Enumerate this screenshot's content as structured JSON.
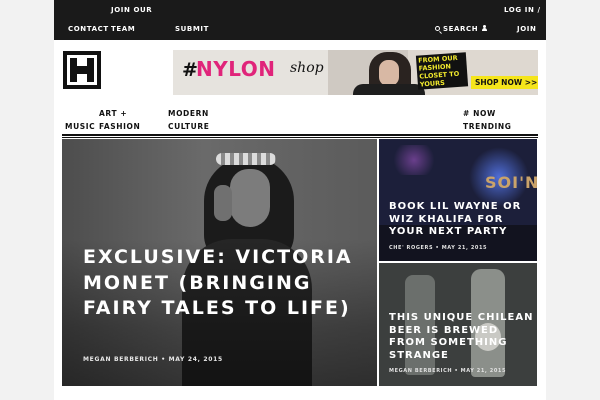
{
  "topbar": {
    "contact": "CONTACT",
    "join_team_line1": "JOIN OUR",
    "join_team_line2": "TEAM",
    "submit": "SUBMIT",
    "search": "SEARCH",
    "login": "LOG IN /",
    "join": "JOIN",
    "icons": [
      "search-icon",
      "user-icon"
    ]
  },
  "logo": {
    "letter": "H",
    "icon": "logo"
  },
  "banner": {
    "hash": "#",
    "brand": "NYLON",
    "shop": "shop",
    "tagline": "FROM OUR FASHION CLOSET TO YOURS",
    "cta": "SHOP NOW >>",
    "colors": {
      "brand": "#e0247a",
      "cta_bg": "#f5e51b"
    }
  },
  "nav": {
    "music": "MUSIC",
    "art_line1": "ART +",
    "art_line2": "FASHION",
    "modern_line1": "MODERN",
    "modern_line2": "CULTURE",
    "now_line1": "# NOW",
    "now_line2": "TRENDING"
  },
  "feature": {
    "headline": "EXCLUSIVE: VICTORIA MONET (BRINGING FAIRY TALES TO LIFE)",
    "byline": "MEGAN BERBERICH • MAY 24, 2015"
  },
  "cards": [
    {
      "title": "BOOK LIL WAYNE OR WIZ KHALIFA FOR YOUR NEXT PARTY",
      "byline": "CHE' ROGERS • MAY 21, 2015",
      "sign_text": "SOI'N"
    },
    {
      "title": "THIS UNIQUE CHILEAN BEER IS BREWED FROM SOMETHING STRANGE",
      "byline": "MEGAN BERBERICH • MAY 21, 2015"
    }
  ]
}
